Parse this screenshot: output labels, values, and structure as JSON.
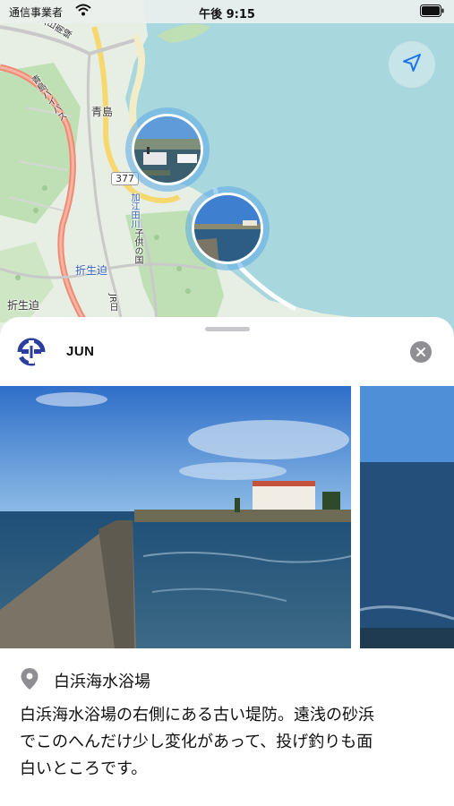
{
  "status_bar": {
    "carrier": "通信事業者",
    "time": "午後 9:15",
    "wifi_icon": "wifi-icon",
    "battery_icon": "battery-icon"
  },
  "map": {
    "labels": {
      "aoshima": "青島",
      "route_377": "377",
      "kanamigawa": "加江田川",
      "kasuzaki_left": "折生迫",
      "kasuzaki_bottom": "折生迫",
      "aoshima_bypass": "青島バイパス",
      "jr_nichinan": "JR日南線",
      "jr_nichinan_2": "JR日",
      "kodomo_road": "子供の国"
    },
    "photo_pins": [
      {
        "name": "pin-harbor",
        "icon": "photo-pin-icon"
      },
      {
        "name": "pin-seawall",
        "icon": "photo-pin-icon"
      }
    ],
    "locate_icon": "location-arrow-icon",
    "colors": {
      "sea": "#a9d7de",
      "land": "#e7eee3",
      "green": "#bfe0b4",
      "road_red": "#f08a73",
      "road_yellow": "#f6d86f",
      "pin_halo": "#5aaae6"
    }
  },
  "sheet": {
    "user": {
      "name": "JUN",
      "avatar_icon": "user-badge-icon"
    },
    "close_icon": "close-icon",
    "photos": [
      {
        "name": "photo-seawall-main"
      },
      {
        "name": "photo-sea-next"
      }
    ],
    "place": {
      "icon": "map-pin-icon",
      "name": "白浜海水浴場"
    },
    "description_lines": [
      "白浜海水浴場の右側にある古い堤防。遠浅の砂浜",
      "でこのへんだけ少し変化があって、投げ釣りも面",
      "白いところです。"
    ]
  }
}
